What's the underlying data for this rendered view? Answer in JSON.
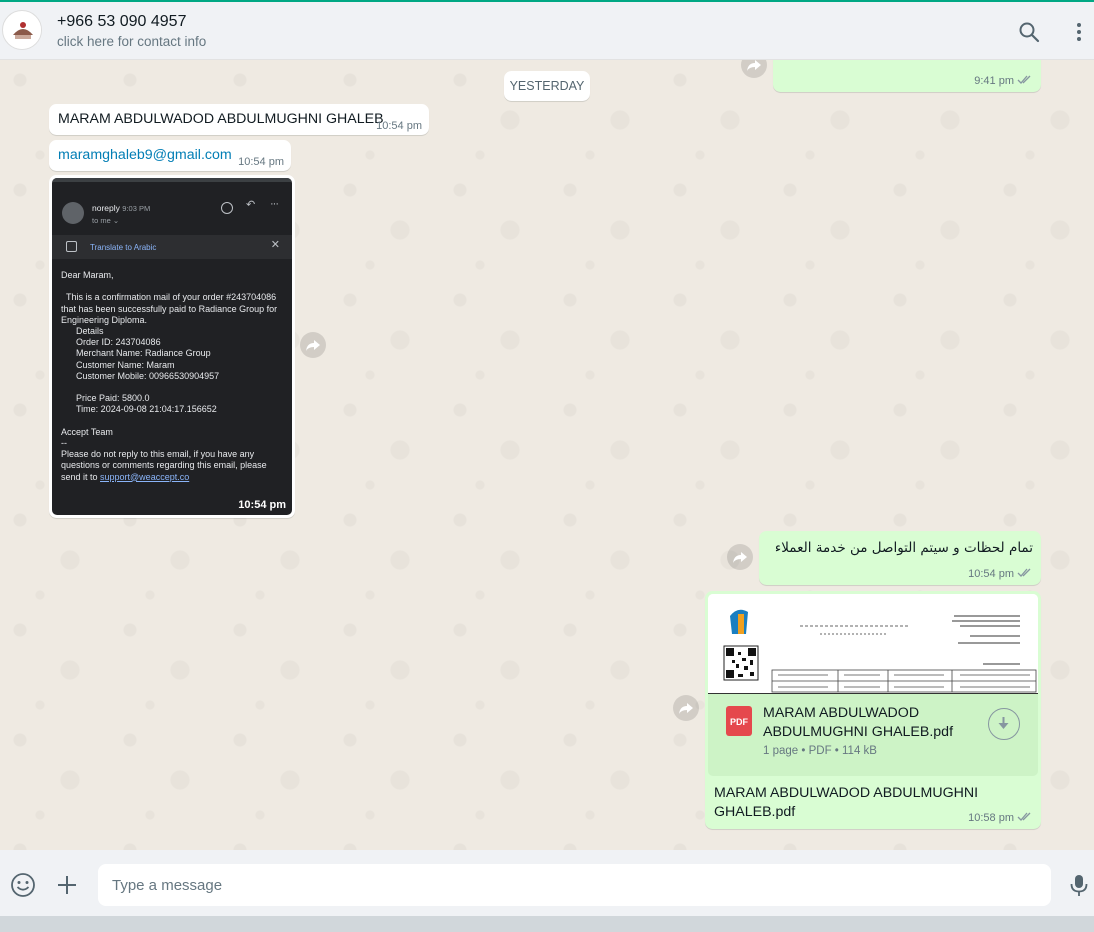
{
  "header": {
    "contact_name": "+966 53 090 4957",
    "contact_sub": "click here for contact info"
  },
  "chat": {
    "top_partial_time": "9:41 pm",
    "date_divider": "YESTERDAY",
    "messages": [
      {
        "text": "MARAM ABDULWADOD ABDULMUGHNI GHALEB",
        "time": "10:54 pm"
      },
      {
        "text": "maramghaleb9@gmail.com",
        "time": "10:54 pm"
      },
      {
        "time": "10:54 pm"
      },
      {
        "text": "تمام لحظات و سيتم التواصل من خدمة العملاء",
        "time": "10:54 pm"
      },
      {
        "file_name": "MARAM ABDULWADOD ABDULMUGHNI GHALEB.pdf",
        "file_meta": "1 page • PDF • 114 kB",
        "caption": "MARAM ABDULWADOD ABDULMUGHNI GHALEB.pdf",
        "time": "10:58 pm",
        "badge": "PDF"
      }
    ],
    "email_shot": {
      "sender": "noreply",
      "sent_time": "9:03 PM",
      "to": "to me",
      "translate_label": "Translate to Arabic",
      "body": "Dear Maram,\n\n  This is a confirmation mail of your order #243704086 that has been successfully paid to Radiance Group for Engineering Diploma.\n      Details\n      Order ID: 243704086\n      Merchant Name: Radiance Group\n      Customer Name: Maram\n      Customer Mobile: 00966530904957\n\n      Price Paid: 5800.0\n      Time: 2024-09-08 21:04:17.156652\n\nAccept Team\n--\nPlease do not reply to this email, if you have any questions or comments regarding this email, please send it to ",
      "support_link": "support@weaccept.co"
    }
  },
  "composer": {
    "placeholder": "Type a message"
  }
}
